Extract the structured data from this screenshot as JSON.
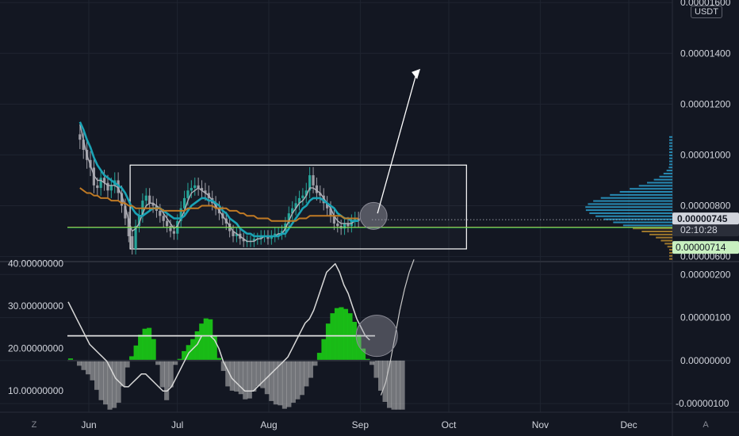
{
  "currency_button": "USDT",
  "scale_buttons": {
    "log": "Z",
    "auto": "A"
  },
  "colors": {
    "background": "#131722",
    "grid": "#1f2430",
    "candle_up": "#26a69a",
    "candle_dn": "#9e9ea6",
    "ema_fast": "#b0b0b8",
    "ema_mid": "#1aa3b5",
    "ema_slow": "#c07a24",
    "baseline": "#f5e960",
    "support_line": "#00c853",
    "box": "#ffffff",
    "osc_green": "#19c316",
    "osc_grey": "#c2c2c2",
    "price_tag_current": "#d1d4dc",
    "price_tag_support": "#c8f0c0",
    "volume_profile_up": "#2da8d8",
    "volume_profile_dn": "#c09030"
  },
  "chart_data": [
    {
      "type": "candlestick",
      "panel": "price",
      "price_axis_labels": [
        "0.00001600",
        "0.00001400",
        "0.00001200",
        "0.00001000",
        "0.00000800",
        "0.00000600"
      ],
      "ylim": [
        5.8e-06,
        1.61e-05
      ],
      "time_labels": [
        "Jun",
        "Jul",
        "Aug",
        "Sep",
        "Oct",
        "Nov",
        "Dec"
      ],
      "time_positions_days": [
        0,
        30,
        61,
        92,
        122,
        153,
        183
      ],
      "xlim_days": [
        -7,
        196
      ],
      "last_price": "0.00000745",
      "countdown": "02:10:28",
      "support_price": "0.00000714",
      "close_series": [
        1.06e-05,
        1.02e-05,
        9.8e-06,
        9.5e-06,
        8.8e-06,
        8.7e-06,
        9.1e-06,
        8.9e-06,
        8.6e-06,
        8.8e-06,
        9e-06,
        8.5e-06,
        8e-06,
        7.5e-06,
        6.8e-06,
        6.3e-06,
        7.2e-06,
        7.6e-06,
        8.2e-06,
        8.4e-06,
        8.1e-06,
        8e-06,
        7.8e-06,
        7.6e-06,
        7.4e-06,
        7.2e-06,
        7e-06,
        6.9e-06,
        7.4e-06,
        7.9e-06,
        8.3e-06,
        8.6e-06,
        8.7e-06,
        8.8e-06,
        8.7e-06,
        8.6e-06,
        8.5e-06,
        8.3e-06,
        8.1e-06,
        7.9e-06,
        7.7e-06,
        7.5e-06,
        7.3e-06,
        7e-06,
        6.8e-06,
        6.9e-06,
        6.7e-06,
        6.6e-06,
        6.6e-06,
        6.6e-06,
        6.7e-06,
        6.7e-06,
        6.8e-06,
        6.8e-06,
        6.7e-06,
        6.8e-06,
        6.9e-06,
        6.9e-06,
        7e-06,
        7.3e-06,
        7.7e-06,
        7.9e-06,
        8.1e-06,
        8.3e-06,
        8.4e-06,
        8.6e-06,
        9.2e-06,
        8.8e-06,
        8.5e-06,
        8.4e-06,
        8.1e-06,
        7.9e-06,
        7.6e-06,
        7.3e-06,
        7.2e-06,
        7.1e-06,
        7.3e-06,
        7.2e-06,
        7.4e-06,
        7.5e-06,
        7.4e-06
      ],
      "series": [
        {
          "values": [
            1.12e-05,
            1.06e-05,
            1e-05,
            9.6e-06,
            9.2e-06,
            9e-06,
            9e-06,
            8.9e-06,
            8.8e-06,
            8.8e-06,
            8.8e-06,
            8.7e-06,
            8.4e-06,
            8e-06,
            7.4e-06,
            7e-06,
            7.1e-06,
            7.3e-06,
            7.7e-06,
            8e-06,
            8.1e-06,
            8.1e-06,
            8e-06,
            7.9e-06,
            7.7e-06,
            7.5e-06,
            7.3e-06,
            7.1e-06,
            7.2e-06,
            7.5e-06,
            7.8e-06,
            8.2e-06,
            8.5e-06,
            8.6e-06,
            8.7e-06,
            8.6e-06,
            8.5e-06,
            8.4e-06,
            8.2e-06,
            8e-06,
            7.8e-06,
            7.6e-06,
            7.4e-06,
            7.2e-06,
            7e-06,
            6.9e-06,
            6.8e-06,
            6.7e-06,
            6.6e-06,
            6.6e-06,
            6.6e-06,
            6.7e-06,
            6.7e-06,
            6.8e-06,
            6.8e-06,
            6.8e-06,
            6.8e-06,
            6.9e-06,
            6.9e-06,
            7.1e-06,
            7.4e-06,
            7.7e-06,
            7.9e-06,
            8.1e-06,
            8.2e-06,
            8.4e-06,
            8.7e-06,
            8.7e-06,
            8.6e-06,
            8.5e-06,
            8.3e-06,
            8.1e-06,
            7.9e-06,
            7.6e-06,
            7.4e-06,
            7.3e-06,
            7.3e-06,
            7.3e-06,
            7.3e-06,
            7.4e-06,
            7.4e-06
          ]
        },
        {
          "values": [
            1.13e-05,
            1.1e-05,
            1.06e-05,
            1.03e-05,
            9.9e-06,
            9.6e-06,
            9.4e-06,
            9.2e-06,
            9.1e-06,
            9e-06,
            8.9e-06,
            8.8e-06,
            8.7e-06,
            8.5e-06,
            8.2e-06,
            7.9e-06,
            7.7e-06,
            7.6e-06,
            7.6e-06,
            7.7e-06,
            7.8e-06,
            7.9e-06,
            7.9e-06,
            7.9e-06,
            7.8e-06,
            7.7e-06,
            7.6e-06,
            7.5e-06,
            7.5e-06,
            7.5e-06,
            7.6e-06,
            7.8e-06,
            8e-06,
            8.1e-06,
            8.2e-06,
            8.3e-06,
            8.3e-06,
            8.2e-06,
            8.2e-06,
            8.1e-06,
            8e-06,
            7.8e-06,
            7.7e-06,
            7.5e-06,
            7.4e-06,
            7.3e-06,
            7.1e-06,
            7e-06,
            6.9e-06,
            6.9e-06,
            6.8e-06,
            6.8e-06,
            6.8e-06,
            6.8e-06,
            6.8e-06,
            6.8e-06,
            6.8e-06,
            6.8e-06,
            6.9e-06,
            6.9e-06,
            7.1e-06,
            7.3e-06,
            7.5e-06,
            7.7e-06,
            7.9e-06,
            8e-06,
            8.2e-06,
            8.3e-06,
            8.3e-06,
            8.3e-06,
            8.2e-06,
            8.1e-06,
            8e-06,
            7.9e-06,
            7.7e-06,
            7.6e-06,
            7.5e-06,
            7.5e-06,
            7.4e-06,
            7.4e-06,
            7.4e-06
          ]
        },
        {
          "values": [
            8.7e-06,
            8.6e-06,
            8.5e-06,
            8.5e-06,
            8.4e-06,
            8.4e-06,
            8.3e-06,
            8.3e-06,
            8.3e-06,
            8.2e-06,
            8.2e-06,
            8.2e-06,
            8.1e-06,
            8.1e-06,
            8e-06,
            8e-06,
            7.9e-06,
            7.9e-06,
            7.9e-06,
            7.9e-06,
            7.9e-06,
            7.9e-06,
            7.9e-06,
            7.9e-06,
            7.8e-06,
            7.8e-06,
            7.8e-06,
            7.8e-06,
            7.8e-06,
            7.8e-06,
            7.8e-06,
            7.9e-06,
            7.9e-06,
            7.9e-06,
            7.9e-06,
            8e-06,
            8e-06,
            8e-06,
            8e-06,
            7.9e-06,
            7.9e-06,
            7.9e-06,
            7.9e-06,
            7.8e-06,
            7.8e-06,
            7.8e-06,
            7.7e-06,
            7.7e-06,
            7.6e-06,
            7.6e-06,
            7.6e-06,
            7.5e-06,
            7.5e-06,
            7.5e-06,
            7.5e-06,
            7.4e-06,
            7.4e-06,
            7.4e-06,
            7.4e-06,
            7.4e-06,
            7.4e-06,
            7.4e-06,
            7.4e-06,
            7.5e-06,
            7.5e-06,
            7.5e-06,
            7.6e-06,
            7.6e-06,
            7.6e-06,
            7.6e-06,
            7.6e-06,
            7.6e-06,
            7.6e-06,
            7.6e-06,
            7.6e-06,
            7.6e-06,
            7.5e-06,
            7.5e-06,
            7.5e-06,
            7.5e-06,
            7.5e-06
          ]
        }
      ]
    },
    {
      "type": "area",
      "panel": "oscillator",
      "left_axis_labels": [
        "40.00000000",
        "30.00000000",
        "20.00000000",
        "10.00000000"
      ],
      "right_axis_labels": [
        "0.00000200",
        "0.00000100",
        "0.00000000",
        "-0.00000100"
      ],
      "ylim_left": [
        5,
        40.5
      ],
      "ylim_right": [
        -1.2e-06,
        2.3e-06
      ],
      "threshold_value": 23,
      "series": [
        {
          "values": [
            5e-08,
            -1e-08,
            -1.2e-07,
            -2.2e-07,
            -3.2e-07,
            -4.6e-07,
            -6.8e-07,
            -9.2e-07,
            -1.02e-06,
            -1.14e-06,
            -1.1e-06,
            -9.8e-07,
            -6e-07,
            -1.6e-07,
            1e-07,
            3.5e-07,
            6e-07,
            7.4e-07,
            7.6e-07,
            5e-07,
            -1e-07,
            -6.2e-07,
            -9.2e-07,
            -6.2e-07,
            -1e-07,
            4e-08,
            2.2e-07,
            3.6e-07,
            5e-07,
            6.8e-07,
            8.6e-07,
            9.8e-07,
            9.6e-07,
            5.6e-07,
            6e-08,
            -2.4e-07,
            -6e-07,
            -7e-07,
            -7.2e-07,
            -7.8e-07,
            -9e-07,
            -8.8e-07,
            -7.2e-07,
            -6e-07,
            -6.4e-07,
            -7.8e-07,
            -9.4e-07,
            -1.02e-06,
            -1.04e-06,
            -1.12e-06,
            -1.08e-06,
            -9.8e-07,
            -9e-07,
            -8e-07,
            -6e-07,
            -4e-07,
            -1.2e-07,
            1.8e-07,
            5e-07,
            8.6e-07,
            1.1e-06,
            1.22e-06,
            1.24e-06,
            1.2e-06,
            1.1e-06,
            9e-07,
            6e-07,
            2.8e-07,
            4e-08,
            -1e-07,
            -4e-07,
            -7e-07,
            -9.6e-07,
            -1.1e-06,
            -1.14e-06,
            -1.14e-06,
            -1.14e-06
          ]
        },
        {
          "values": [
            31,
            29,
            27,
            25,
            23,
            21,
            20,
            19,
            18,
            17,
            15,
            13,
            12,
            11,
            11,
            12,
            13,
            14,
            14,
            13,
            12,
            11,
            10,
            10,
            11,
            13,
            15,
            17,
            19,
            20,
            21,
            23,
            23,
            23,
            22,
            20,
            17,
            15,
            13,
            12,
            11,
            10,
            10,
            10,
            11,
            12,
            13,
            14,
            15,
            16,
            17,
            18,
            20,
            22,
            24,
            26,
            27,
            29,
            32,
            35,
            38,
            39,
            40,
            38,
            35,
            33,
            30,
            27,
            25,
            23,
            22
          ]
        },
        {
          "values": [
            9,
            12,
            17,
            23,
            29,
            34,
            38,
            41
          ]
        }
      ]
    }
  ]
}
